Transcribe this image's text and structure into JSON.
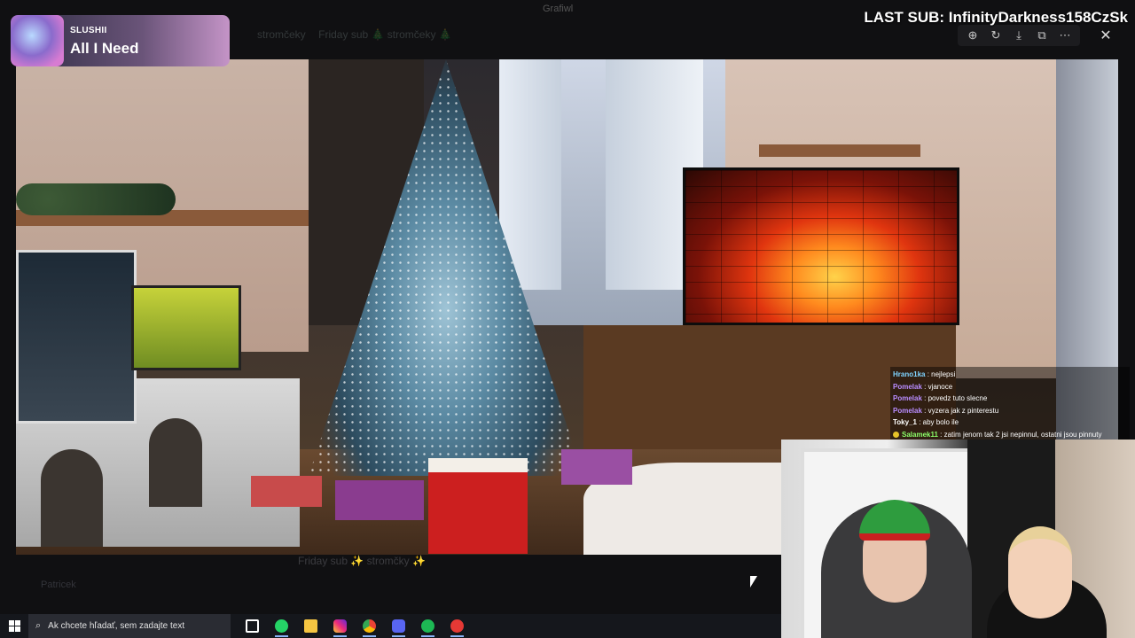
{
  "background_app": {
    "window_title": "Grafiwl",
    "header_items": [
      "stromčeky",
      "Friday sub 🎄 stromčeky 🎄"
    ],
    "caption": "Friday sub ✨ stromčky ✨",
    "user_name": "Patricek"
  },
  "viewer_toolbar": {
    "zoom_icon": "magnifier-plus-icon",
    "rotate_icon": "rotate-icon",
    "download_icon": "download-icon",
    "open_icon": "open-external-icon",
    "more_icon": "more-icon",
    "close_icon": "close-icon",
    "glyphs": {
      "zoom": "⊕",
      "rotate": "↻",
      "download": "⤓",
      "open": "⧉",
      "more": "⋯",
      "close": "✕"
    }
  },
  "now_playing": {
    "artist": "SLUSHII",
    "title": "All I Need"
  },
  "last_sub": {
    "text": "LAST SUB: InfinityDarkness158CzSk"
  },
  "chat": {
    "messages": [
      {
        "user": "Hrano1ka",
        "color": "#7fd3ff",
        "text": " : nejlepsi"
      },
      {
        "user": "Pomelak",
        "color": "#b88cff",
        "text": " : vjanoce"
      },
      {
        "user": "Pomelak",
        "color": "#b88cff",
        "text": " : povedz tuto slecne"
      },
      {
        "user": "Pomelak",
        "color": "#b88cff",
        "text": " : vyzera jak z pinterestu"
      },
      {
        "user": "Toky_1",
        "color": "#ffffff",
        "text": " : aby bolo ile"
      },
      {
        "user": "Salamek11",
        "color": "#8cff6a",
        "text": " : zatim jenom tak 2 jsi nepinnul, ostatni jsou pinnuty"
      }
    ]
  },
  "taskbar": {
    "search_placeholder": "Ak chcete hľadať, sem zadajte text",
    "apps": [
      {
        "name": "task-view",
        "color": "#ffffff"
      },
      {
        "name": "whatsapp",
        "color": "#25d366"
      },
      {
        "name": "file-explorer",
        "color": "#f5c542"
      },
      {
        "name": "instagram",
        "color": "#d6249f"
      },
      {
        "name": "chrome",
        "color": "#ea4335"
      },
      {
        "name": "discord",
        "color": "#5865f2"
      },
      {
        "name": "spotify",
        "color": "#1db954"
      },
      {
        "name": "screen-recorder",
        "color": "#e53935"
      }
    ]
  }
}
